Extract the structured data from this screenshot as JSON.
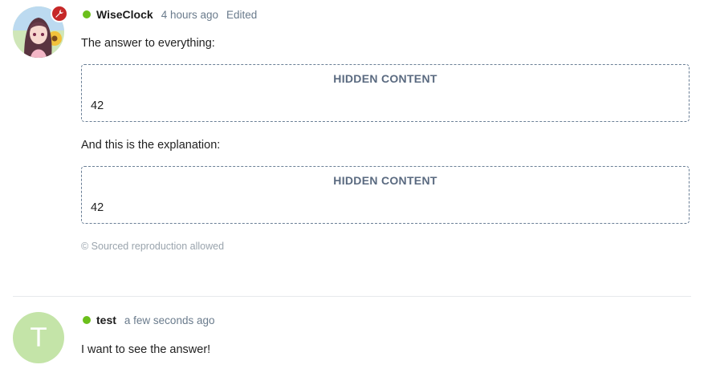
{
  "posts": [
    {
      "username": "WiseClock",
      "time": "4 hours ago",
      "edited": "Edited",
      "status_color": "#6bbf1b",
      "badge_icon": "wrench-icon",
      "paragraph1": "The answer to everything:",
      "hidden1": {
        "title": "HIDDEN CONTENT",
        "content": "42"
      },
      "paragraph2": "And this is the explanation:",
      "hidden2": {
        "title": "HIDDEN CONTENT",
        "content": "42"
      },
      "copyright": "© Sourced reproduction allowed"
    },
    {
      "username": "test",
      "time": "a few seconds ago",
      "avatar_letter": "T",
      "avatar_color": "#c4e4a8",
      "status_color": "#6bbf1b",
      "paragraph1": "I want to see the answer!"
    }
  ]
}
